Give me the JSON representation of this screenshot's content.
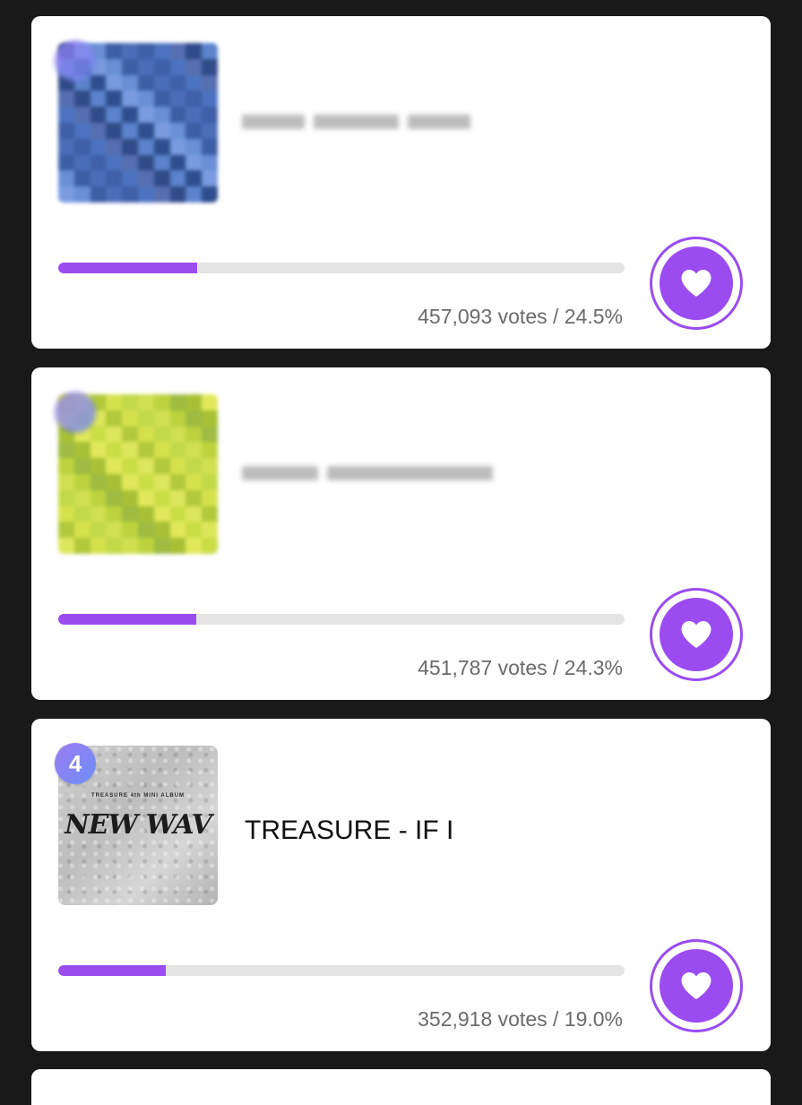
{
  "accent_color": "#9a4cf0",
  "entries": [
    {
      "rank": "",
      "title": "",
      "blurred": true,
      "votes_text": "457,093 votes / 24.5%",
      "progress_percent": 24.5,
      "thumb_colors": [
        "#2e4d8e",
        "#3c5ea5",
        "#4d73c0",
        "#5c83cc",
        "#6a8fd6",
        "#3f5fa8",
        "#2f4b88",
        "#7a9be0",
        "#4c6db8",
        "#566fb0"
      ]
    },
    {
      "rank": "",
      "title": "",
      "blurred": true,
      "votes_text": "451,787 votes / 24.3%",
      "progress_percent": 24.3,
      "thumb_colors": [
        "#c9dd45",
        "#d4e24c",
        "#bcd33e",
        "#e0e95a",
        "#b1c93a",
        "#cfe050",
        "#a8c035",
        "#dce75c",
        "#c2d948",
        "#9fbb42"
      ]
    },
    {
      "rank": "4",
      "title": "TREASURE - IF I",
      "blurred": false,
      "album_subtitle": "TREASURE 4th MINI ALBUM",
      "album_title": "NEW WAV",
      "votes_text": "352,918 votes / 19.0%",
      "progress_percent": 19.0
    }
  ],
  "icons": {
    "vote": "heart-icon"
  }
}
